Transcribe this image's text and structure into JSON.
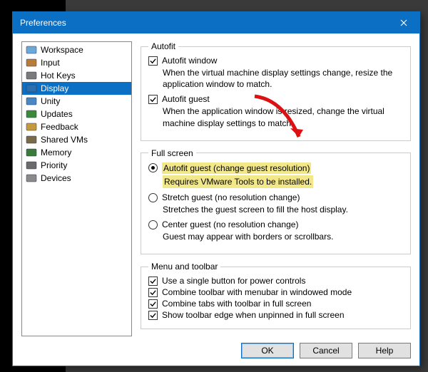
{
  "title": "Preferences",
  "sidebar": {
    "items": [
      {
        "label": "Workspace",
        "icon": "workspace-icon",
        "selected": false
      },
      {
        "label": "Input",
        "icon": "input-icon",
        "selected": false
      },
      {
        "label": "Hot Keys",
        "icon": "hotkeys-icon",
        "selected": false
      },
      {
        "label": "Display",
        "icon": "display-icon",
        "selected": true
      },
      {
        "label": "Unity",
        "icon": "unity-icon",
        "selected": false
      },
      {
        "label": "Updates",
        "icon": "updates-icon",
        "selected": false
      },
      {
        "label": "Feedback",
        "icon": "feedback-icon",
        "selected": false
      },
      {
        "label": "Shared VMs",
        "icon": "shared-icon",
        "selected": false
      },
      {
        "label": "Memory",
        "icon": "memory-icon",
        "selected": false
      },
      {
        "label": "Priority",
        "icon": "priority-icon",
        "selected": false
      },
      {
        "label": "Devices",
        "icon": "devices-icon",
        "selected": false
      }
    ]
  },
  "autofit": {
    "legend": "Autofit",
    "window_label": "Autofit window",
    "window_checked": true,
    "window_desc": "When the virtual machine display settings change, resize the application window to match.",
    "guest_label": "Autofit guest",
    "guest_checked": true,
    "guest_desc": "When the application window is resized, change the virtual machine display settings to match."
  },
  "fullscreen": {
    "legend": "Full screen",
    "opt1_label": "Autofit guest (change guest resolution)",
    "opt1_desc": "Requires VMware Tools to be installed.",
    "opt2_label": "Stretch guest (no resolution change)",
    "opt2_desc": "Stretches the guest screen to fill the host display.",
    "opt3_label": "Center guest (no resolution change)",
    "opt3_desc": "Guest may appear with borders or scrollbars.",
    "selected": "opt1"
  },
  "menutoolbar": {
    "legend": "Menu and toolbar",
    "c1": {
      "label": "Use a single button for power controls",
      "checked": true
    },
    "c2": {
      "label": "Combine toolbar with menubar in windowed mode",
      "checked": true
    },
    "c3": {
      "label": "Combine tabs with toolbar in full screen",
      "checked": true
    },
    "c4": {
      "label": "Show toolbar edge when unpinned in full screen",
      "checked": true
    }
  },
  "buttons": {
    "ok": "OK",
    "cancel": "Cancel",
    "help": "Help"
  }
}
